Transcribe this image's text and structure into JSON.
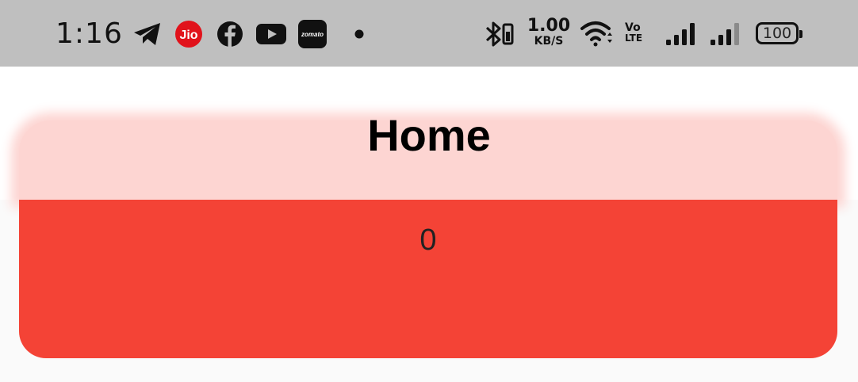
{
  "status_bar": {
    "time": "1:16",
    "notification_icons": [
      "telegram-icon",
      "jio-icon",
      "facebook-icon",
      "youtube-icon",
      "zomato-icon",
      "dot-icon"
    ],
    "jio_label": "Jio",
    "zomato_label": "zomato",
    "speed_value": "1.00",
    "speed_unit": "KB/S",
    "volte_top": "Vo",
    "volte_bottom": "LTE",
    "battery": "100"
  },
  "header": {
    "title": "Home"
  },
  "card": {
    "value": "0"
  },
  "colors": {
    "status_bar_bg": "#bfbfbf",
    "header_bg": "#fdd5d2",
    "card_bg": "#f44336",
    "jio_red": "#e1121b"
  }
}
